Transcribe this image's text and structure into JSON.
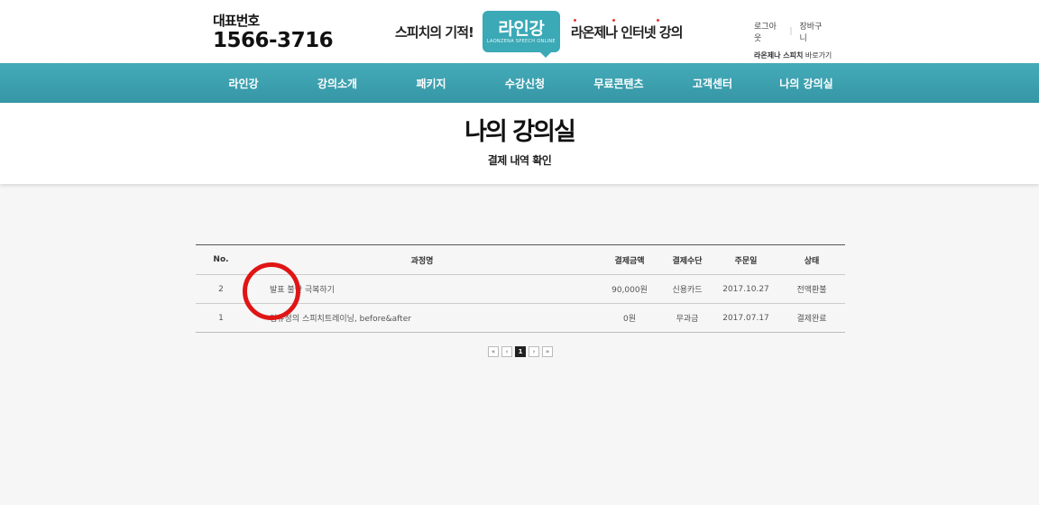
{
  "header": {
    "phone_label": "대표번호",
    "phone_number": "1566-3716",
    "tagline_left": "스피치의 기적!",
    "logo_main": "라인강",
    "logo_sub": "LAONZENA SPEECH ONLINE",
    "tagline_right": "라온제나 인터넷 강의",
    "logout": "로그아웃",
    "cart": "장바구니",
    "shortcut_brand": "라온제나 스피치",
    "shortcut_suffix": " 바로가기"
  },
  "nav": {
    "items": [
      "라인강",
      "강의소개",
      "패키지",
      "수강신청",
      "무료콘텐츠",
      "고객센터",
      "나의 강의실"
    ]
  },
  "title": {
    "main": "나의 강의실",
    "sub": "결제 내역 확인"
  },
  "table": {
    "headers": [
      "No.",
      "과정명",
      "결제금액",
      "결제수단",
      "주문일",
      "상태"
    ],
    "rows": [
      {
        "no": "2",
        "course": "발표 불안 극복하기",
        "amount": "90,000원",
        "method": "신용카드",
        "date": "2017.10.27",
        "status": "전액환불"
      },
      {
        "no": "1",
        "course": "임유정의 스피치트레이닝, before&after",
        "amount": "0원",
        "method": "무과금",
        "date": "2017.07.17",
        "status": "결제완료"
      }
    ]
  },
  "pager": {
    "first": "«",
    "prev": "‹",
    "current": "1",
    "next": "›",
    "last": "»"
  },
  "colors": {
    "nav": "#3ba2b1",
    "logo": "#3ba9b6",
    "marker": "#e01515"
  }
}
